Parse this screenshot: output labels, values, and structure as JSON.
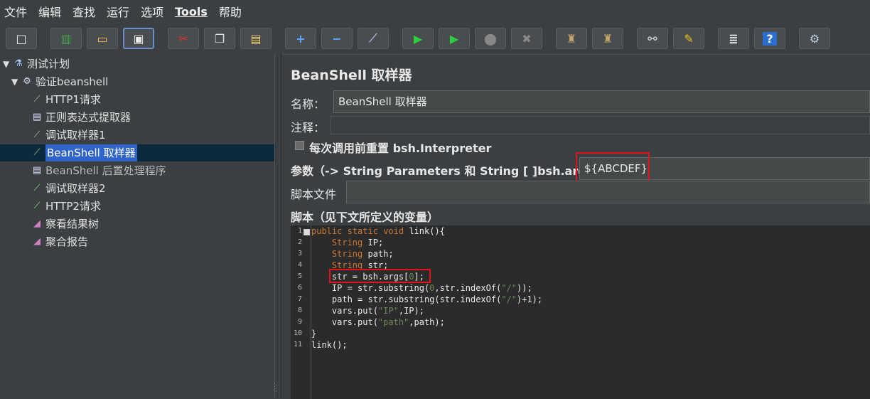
{
  "menu": [
    "文件",
    "编辑",
    "查找",
    "运行",
    "选项",
    "Tools",
    "帮助"
  ],
  "toolbar": {
    "buttons": [
      {
        "name": "new-icon",
        "glyph": "□",
        "color": "#f4f4f0"
      },
      {
        "name": "templates-icon",
        "glyph": "▥",
        "color": "#3fa34d"
      },
      {
        "name": "open-icon",
        "glyph": "▭",
        "color": "#f0c040"
      },
      {
        "name": "save-icon",
        "glyph": "▣",
        "color": "#e8e8e8"
      },
      {
        "name": "cut-icon",
        "glyph": "✂",
        "color": "#e03030"
      },
      {
        "name": "copy-icon",
        "glyph": "❐",
        "color": "#e0e0e0"
      },
      {
        "name": "paste-icon",
        "glyph": "▤",
        "color": "#f0d070"
      },
      {
        "name": "expand-icon",
        "glyph": "+",
        "color": "#5aa8ff"
      },
      {
        "name": "collapse-icon",
        "glyph": "−",
        "color": "#5aa8ff"
      },
      {
        "name": "toggle-icon",
        "glyph": "⟋",
        "color": "#9ad"
      },
      {
        "name": "start-icon",
        "glyph": "▶",
        "color": "#2ecc40"
      },
      {
        "name": "start-no-pause-icon",
        "glyph": "▶",
        "color": "#2ecc40"
      },
      {
        "name": "stop-icon",
        "glyph": "⬤",
        "color": "#888"
      },
      {
        "name": "shutdown-icon",
        "glyph": "✖",
        "color": "#888"
      },
      {
        "name": "clear-icon",
        "glyph": "♜",
        "color": "#c9a76a"
      },
      {
        "name": "clear-all-icon",
        "glyph": "♜",
        "color": "#c9a76a"
      },
      {
        "name": "search-icon",
        "glyph": "⚯",
        "color": "#ddd"
      },
      {
        "name": "reset-search-icon",
        "glyph": "✎",
        "color": "#f0c020"
      },
      {
        "name": "function-helper-icon",
        "glyph": "≣",
        "color": "#eee"
      },
      {
        "name": "help-icon",
        "glyph": "?",
        "color": "#fff"
      },
      {
        "name": "remote-icon",
        "glyph": "⚙",
        "color": "#bcd"
      }
    ]
  },
  "tree": {
    "items": [
      {
        "label": "测试计划",
        "indent": 0,
        "icon": "flask-icon",
        "toggle": "▼"
      },
      {
        "label": "验证beanshell",
        "indent": 1,
        "icon": "gear-icon",
        "toggle": "▼"
      },
      {
        "label": "HTTP1请求",
        "indent": 2,
        "icon": "pipette-icon",
        "toggle": ""
      },
      {
        "label": "正则表达式提取器",
        "indent": 2,
        "icon": "document-icon",
        "toggle": ""
      },
      {
        "label": "调试取样器1",
        "indent": 2,
        "icon": "pipette-icon",
        "toggle": ""
      },
      {
        "label": "BeanShell 取样器",
        "indent": 2,
        "icon": "pipette-icon",
        "toggle": "",
        "selected": true
      },
      {
        "label": "BeanShell 后置处理程序",
        "indent": 2,
        "icon": "document-icon",
        "toggle": "",
        "dim": true
      },
      {
        "label": "调试取样器2",
        "indent": 2,
        "icon": "pipette-icon",
        "toggle": ""
      },
      {
        "label": "HTTP2请求",
        "indent": 2,
        "icon": "pipette-icon",
        "toggle": ""
      },
      {
        "label": "察看结果树",
        "indent": 2,
        "icon": "chart-icon",
        "toggle": ""
      },
      {
        "label": "聚合报告",
        "indent": 2,
        "icon": "chart-icon",
        "toggle": ""
      }
    ]
  },
  "panel": {
    "title": "BeanShell 取样器",
    "name_label": "名称：",
    "name_value": "BeanShell 取样器",
    "comment_label": "注释：",
    "comment_value": "",
    "reset_label": "每次调用前重置 bsh.Interpreter",
    "params_label": "参数（-> String Parameters 和 String [ ]bsh.args）",
    "params_value": "${ABCDEF}",
    "script_file_label": "脚本文件",
    "script_file_value": "",
    "script_label": "脚本（见下文所定义的变量）"
  },
  "code": {
    "line_numbers": [
      "1",
      "2",
      "3",
      "4",
      "5",
      "6",
      "7",
      "8",
      "9",
      "10",
      "11"
    ],
    "lines": [
      "public static void link(){",
      "    String IP;",
      "    String path;",
      "    String str;",
      "    str = bsh.args[0];",
      "    IP = str.substring(0,str.indexOf(\"/\"));",
      "    path = str.substring(str.indexOf(\"/\")+1);",
      "    vars.put(\"IP\",IP);",
      "    vars.put(\"path\",path);",
      "}",
      "link();"
    ]
  },
  "colors": {
    "highlight": "#e0121a",
    "selection": "#2f65ca"
  }
}
